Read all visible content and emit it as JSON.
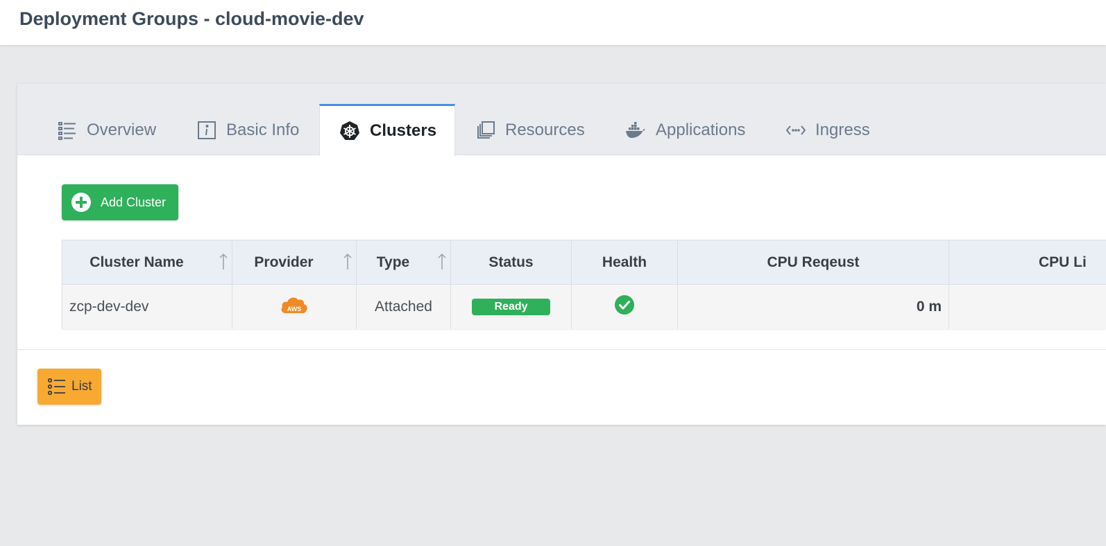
{
  "header": {
    "title": "Deployment Groups - cloud-movie-dev"
  },
  "tabs": [
    {
      "label": "Overview",
      "icon": "list-icon",
      "active": false
    },
    {
      "label": "Basic Info",
      "icon": "info-icon",
      "active": false
    },
    {
      "label": "Clusters",
      "icon": "kubernetes-icon",
      "active": true
    },
    {
      "label": "Resources",
      "icon": "stack-icon",
      "active": false
    },
    {
      "label": "Applications",
      "icon": "docker-icon",
      "active": false
    },
    {
      "label": "Ingress",
      "icon": "code-icon",
      "active": false
    }
  ],
  "actions": {
    "add_cluster_label": "Add Cluster",
    "list_label": "List"
  },
  "table": {
    "columns": [
      "Cluster Name",
      "Provider",
      "Type",
      "Status",
      "Health",
      "CPU Reqeust",
      "CPU Li"
    ],
    "rows": [
      {
        "cluster_name": "zcp-dev-dev",
        "provider": "AWS",
        "type": "Attached",
        "status": "Ready",
        "health": "check-circle-icon",
        "cpu_request": "0 m"
      }
    ]
  },
  "colors": {
    "accent": "#4a90e2",
    "success": "#2fb05a",
    "warning": "#f7a932",
    "aws": "#f08a24"
  }
}
